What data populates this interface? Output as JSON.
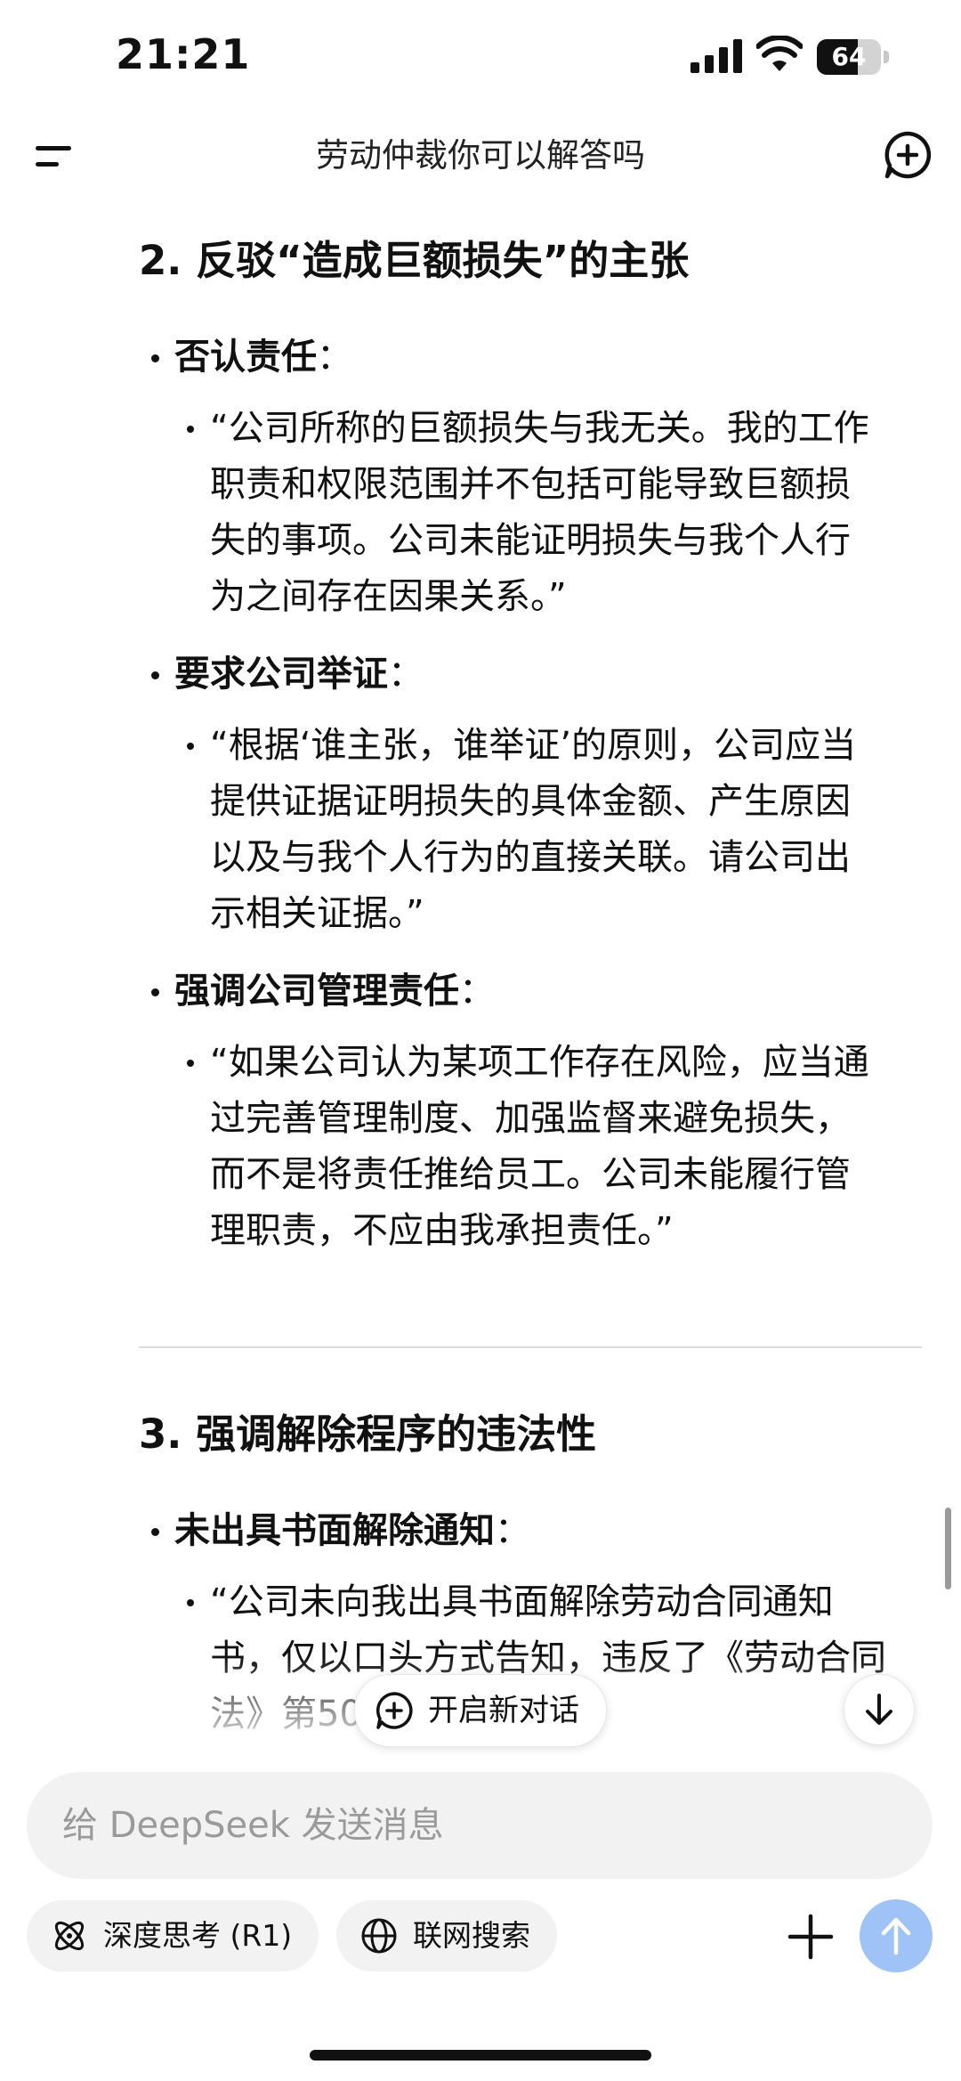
{
  "status_bar": {
    "time": "21:21",
    "battery": "64",
    "battery_level": 0.64
  },
  "header": {
    "title": "劳动仲裁你可以解答吗"
  },
  "content": {
    "section2": {
      "heading": "2. 反驳“造成巨额损失”的主张",
      "items": [
        {
          "label": "否认责任",
          "colon": "：",
          "quote_lines": [
            "“公司所称的巨额损失与我无关。我的工作",
            "职责和权限范围并不包括可能导致巨额损",
            "失的事项。公司未能证明损失与我个人行",
            "为之间存在因果关系。”"
          ]
        },
        {
          "label": "要求公司举证",
          "colon": "：",
          "quote_lines": [
            "“根据‘谁主张，谁举证’的原则，公司应当",
            "提供证据证明损失的具体金额、产生原因",
            "以及与我个人行为的直接关联。请公司出",
            "示相关证据。”"
          ]
        },
        {
          "label": "强调公司管理责任",
          "colon": "：",
          "quote_lines": [
            "“如果公司认为某项工作存在风险，应当通",
            "过完善管理制度、加强监督来避免损失，",
            "而不是将责任推给员工。公司未能履行管",
            "理职责，不应由我承担责任。”"
          ]
        }
      ]
    },
    "section3": {
      "heading": "3. 强调解除程序的违法性",
      "items": [
        {
          "label": "未出具书面解除通知",
          "colon": "：",
          "quote_lines": [
            "“公司未向我出具书面解除劳动合同通知",
            "书，仅以口头方式告知，违反了《劳动合同",
            "法》第50"
          ]
        }
      ]
    }
  },
  "floating": {
    "new_dialog_label": "开启新对话"
  },
  "composer": {
    "placeholder": "给 DeepSeek 发送消息",
    "deep_think_label": "深度思考 (R1)",
    "web_search_label": "联网搜索"
  },
  "colors": {
    "send_button": "#9fc3f7",
    "input_bg": "#f2f2f3"
  },
  "icons": [
    "menu-icon",
    "new-chat-icon",
    "chat-plus-icon",
    "arrow-down-icon",
    "atom-icon",
    "globe-icon",
    "plus-icon",
    "arrow-up-icon"
  ]
}
